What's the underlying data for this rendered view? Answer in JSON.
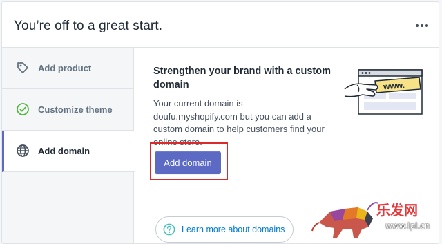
{
  "header": {
    "title": "You’re off to a great start."
  },
  "sidebar": {
    "items": [
      {
        "label": "Add product",
        "icon": "tag-icon",
        "active": false
      },
      {
        "label": "Customize theme",
        "icon": "check-circle-icon",
        "active": false
      },
      {
        "label": "Add domain",
        "icon": "globe-icon",
        "active": true
      }
    ]
  },
  "main": {
    "heading": "Strengthen your brand with a custom domain",
    "description": "Your current domain is doufu.myshopify.com but you can add a custom domain to help customers find your online store.",
    "primary_button": "Add domain",
    "learn_more": "Learn more about domains",
    "illustration_text": "www."
  },
  "watermark": {
    "brand": "乐发网",
    "url": "www.lpl.cn"
  },
  "colors": {
    "accent": "#5c6ac4",
    "link": "#007ace",
    "highlight": "#d92b2b",
    "sidebar_bg": "#f4f6f8",
    "check": "#50b83c"
  }
}
